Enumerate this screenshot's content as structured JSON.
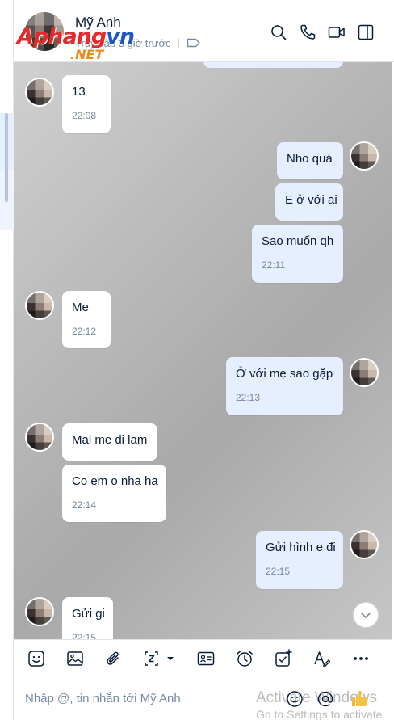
{
  "header": {
    "name": "Mỹ Anh",
    "status": "Truy cập 3 giờ trước"
  },
  "watermark": {
    "main": "Aphang",
    "vn": "vn",
    "net": ".NET"
  },
  "messages": [
    {
      "dir": "in",
      "text": "13",
      "time": "22:08"
    },
    {
      "dir": "out",
      "text": "Nho quá"
    },
    {
      "dir": "out",
      "text": "E ở với ai"
    },
    {
      "dir": "out",
      "text": "Sao muốn qh",
      "time": "22:11"
    },
    {
      "dir": "in",
      "text": "Me",
      "time": "22:12"
    },
    {
      "dir": "out",
      "text": "Ở với mẹ sao gặp",
      "time": "22:13"
    },
    {
      "dir": "in",
      "text": "Mai me di lam"
    },
    {
      "dir": "in",
      "text": "Co em o nha ha",
      "time": "22:14"
    },
    {
      "dir": "out",
      "text": "Gửi hình e đi",
      "time": "22:15"
    },
    {
      "dir": "in",
      "text": "Gửi gi",
      "time": "22:15"
    }
  ],
  "composer": {
    "placeholder": "Nhập @, tin nhắn tới Mỹ Anh"
  },
  "os_overlay": {
    "line1": "Activate Windows",
    "line2": "Go to Settings to activate"
  },
  "icons": {
    "header": [
      "search-icon",
      "phone-icon",
      "video-call-icon",
      "sidebar-toggle-icon",
      "tag-icon"
    ],
    "toolbar": [
      "sticker-icon",
      "image-icon",
      "attachment-icon",
      "screenshot-icon",
      "contact-card-icon",
      "reminder-icon",
      "task-icon",
      "text-format-icon",
      "more-icon"
    ],
    "composer": [
      "emoji-icon",
      "mention-icon",
      "like-icon"
    ]
  },
  "colors": {
    "accent": "#0068ff",
    "outgoing": "#e5efff",
    "incoming": "#ffffff",
    "muted": "#7589a3"
  }
}
